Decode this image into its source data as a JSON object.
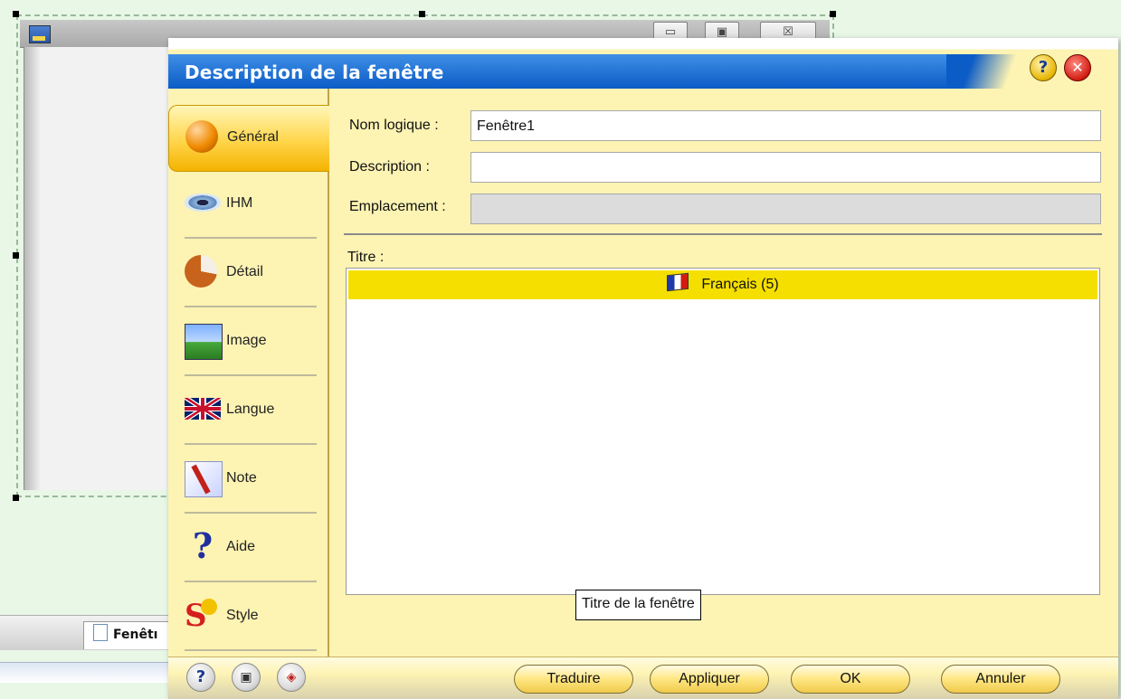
{
  "background_window": {
    "controls": {
      "minimize": "▭",
      "maximize": "▣",
      "close": "☒"
    },
    "bottom_tab": {
      "label": "Fenêtı"
    }
  },
  "dialog": {
    "title": "Description de la fenêtre",
    "help_glyph": "?",
    "close_glyph": "✕",
    "sidebar": {
      "items": [
        {
          "label": "Général",
          "icon": "general-orb-icon",
          "active": true
        },
        {
          "label": "IHM",
          "icon": "eye-icon",
          "active": false
        },
        {
          "label": "Détail",
          "icon": "pie-chart-icon",
          "active": false
        },
        {
          "label": "Image",
          "icon": "landscape-image-icon",
          "active": false
        },
        {
          "label": "Langue",
          "icon": "uk-flag-icon",
          "active": false
        },
        {
          "label": "Note",
          "icon": "note-pencil-icon",
          "active": false
        },
        {
          "label": "Aide",
          "icon": "question-mark-icon",
          "active": false
        },
        {
          "label": "Style",
          "icon": "style-s-icon",
          "active": false
        }
      ]
    },
    "form": {
      "nom_logique": {
        "label": "Nom logique :",
        "value": "Fenêtre1"
      },
      "description": {
        "label": "Description :",
        "value": ""
      },
      "emplacement": {
        "label": "Emplacement :",
        "value": ""
      },
      "titre": {
        "label": "Titre :",
        "languages": [
          {
            "label": "Français (5)",
            "icon": "french-flag-icon",
            "selected": true
          }
        ]
      }
    },
    "tooltip": "Titre de la fenêtre",
    "footer": {
      "traduire": "Traduire",
      "appliquer": "Appliquer",
      "ok": "OK",
      "annuler": "Annuler",
      "help_glyph": "?"
    }
  },
  "colors": {
    "title_bar": "#0b5cc6",
    "dialog_bg": "#fdf3b3",
    "selected_row": "#f5df00",
    "active_tab": "#ffd54a"
  }
}
